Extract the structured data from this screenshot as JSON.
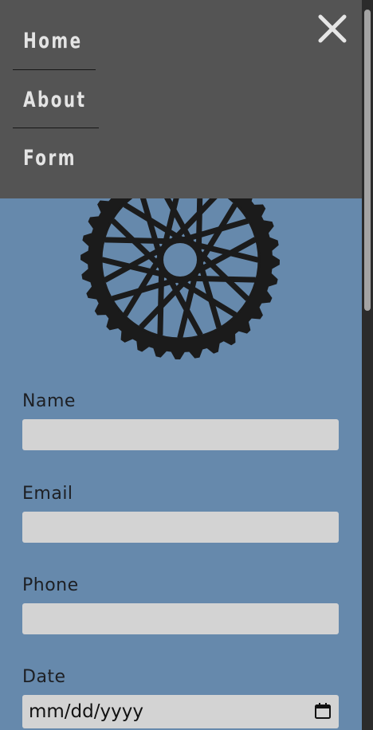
{
  "nav": {
    "items": [
      {
        "label": "Home"
      },
      {
        "label": "About"
      },
      {
        "label": "Form"
      }
    ],
    "close_icon": "close-x-icon"
  },
  "logo": {
    "icon": "spoked-wheel-icon"
  },
  "form": {
    "fields": [
      {
        "label": "Name",
        "value": "",
        "type": "text"
      },
      {
        "label": "Email",
        "value": "",
        "type": "email"
      },
      {
        "label": "Phone",
        "value": "",
        "type": "tel"
      },
      {
        "label": "Date",
        "placeholder": "mm/dd/yyyy",
        "type": "date",
        "icon": "calendar-icon"
      }
    ]
  },
  "colors": {
    "page_background": "#6689ac",
    "menu_background": "#545454",
    "menu_text": "#e4e4e4",
    "input_background": "#d3d3d3",
    "label_text": "#1d1f23",
    "logo": "#1b1b1b"
  }
}
